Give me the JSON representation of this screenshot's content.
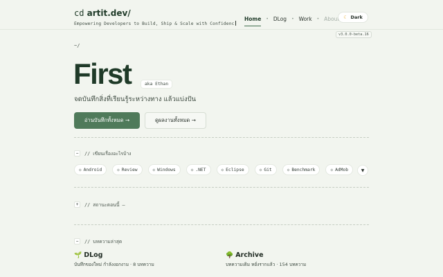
{
  "header": {
    "logo_prefix": "cd",
    "logo_name": "artit.dev/",
    "tagline": "Empowering Developers to Build, Ship & Scale with Confidenc",
    "nav": [
      {
        "label": "Home"
      },
      {
        "label": "DLog"
      },
      {
        "label": "Work"
      },
      {
        "label": "About"
      }
    ],
    "theme_toggle": {
      "icon": "☾",
      "label": "Dark"
    },
    "version": "v3.0.0-beta.16"
  },
  "path": "~/",
  "hero": {
    "title": "First",
    "aka": "aka Ethan",
    "subtitle": "จดบันทึกสิ่งที่เรียนรู้ระหว่างทาง แล้วแบ่งปัน",
    "primary_button": "อ่านบันทึกทั้งหมด →",
    "secondary_button": "ดูผลงานทั้งหมด →"
  },
  "sections": {
    "topics": {
      "toggle": "−",
      "label": "// เขียนเรื่องอะไรบ้าง"
    },
    "status": {
      "toggle": "+",
      "label": "// สถานะตอนนี้ —"
    },
    "latest": {
      "toggle": "−",
      "label": "// บทความล่าสุด"
    }
  },
  "tags": [
    "Android",
    "Review",
    "Windows",
    ".NET",
    "Eclipse",
    "Git",
    "Benchmark",
    "AdMob"
  ],
  "tag_icon": "tag-icon",
  "expand_icon": "▼",
  "cards": {
    "dlog": {
      "emoji": "🌱",
      "title": "DLog",
      "desc": "บันทึกของใหม่ กำลังงอกงาม · 8 บทความ"
    },
    "archive": {
      "emoji": "🌳",
      "title": "Archive",
      "desc": "บทความเดิม หยั่งรากแล้ว · 154 บทความ"
    }
  },
  "colors": {
    "background": "#f2f5ef",
    "accent": "#4f7a5a",
    "heading": "#1f3a28"
  }
}
